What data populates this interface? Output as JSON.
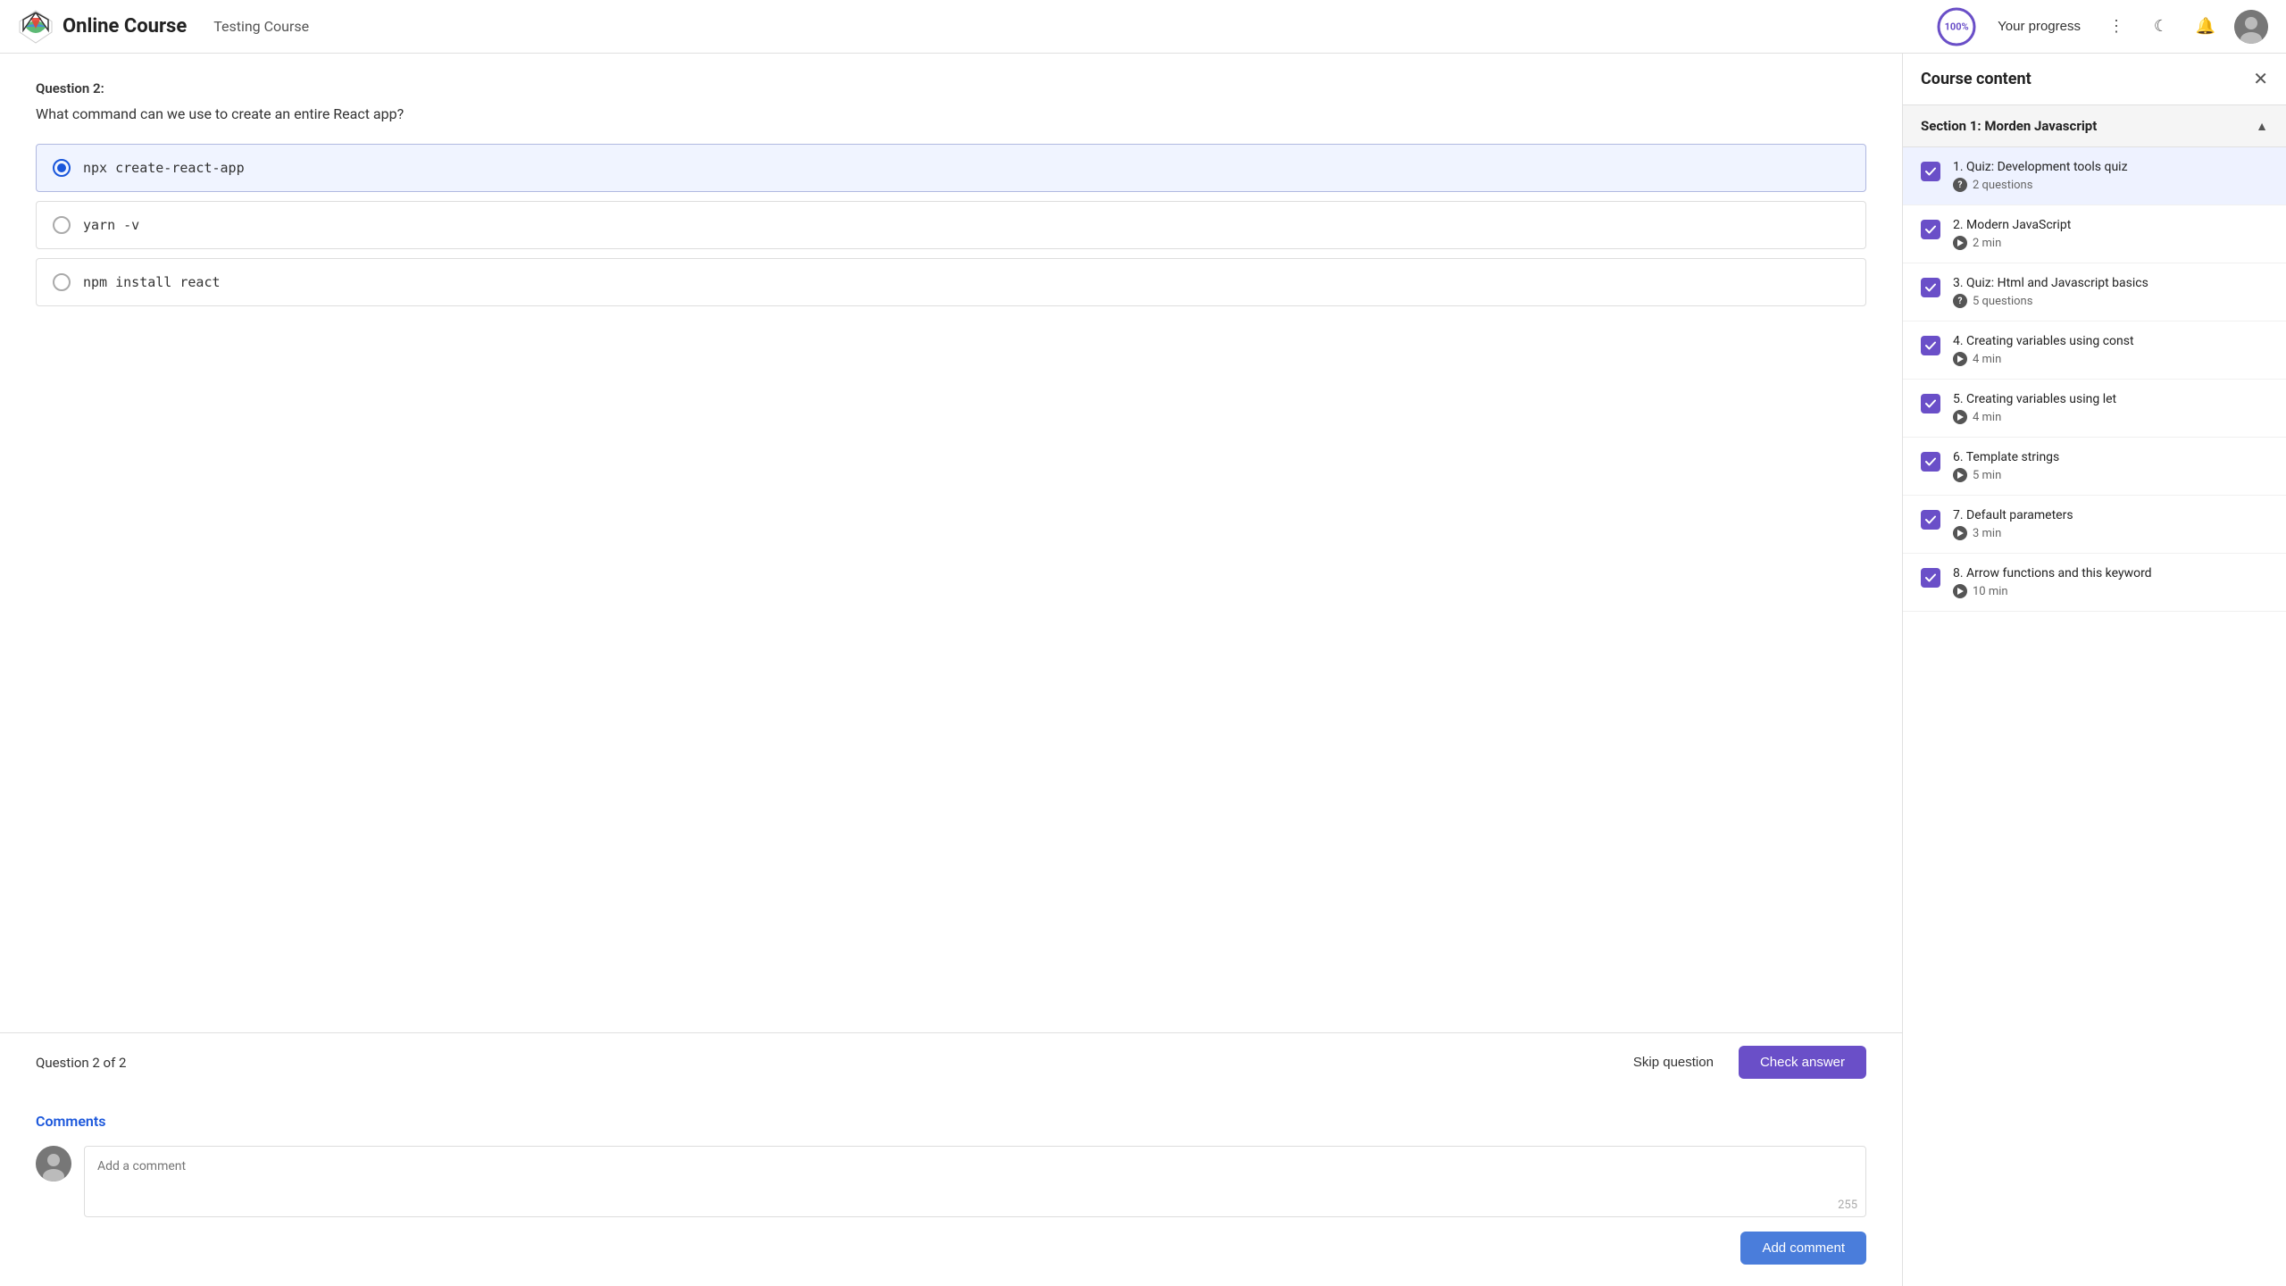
{
  "header": {
    "logo_text": "Online Course",
    "course_title": "Testing Course",
    "progress_percent": "100%",
    "progress_value": 100,
    "your_progress_label": "Your progress",
    "more_icon": "⋮",
    "dark_mode_icon": "☾",
    "bell_icon": "🔔"
  },
  "question": {
    "label": "Question 2:",
    "text": "What command can we use to create an entire React app?",
    "options": [
      {
        "id": "opt1",
        "text": "npx create-react-app",
        "selected": true
      },
      {
        "id": "opt2",
        "text": "yarn -v",
        "selected": false
      },
      {
        "id": "opt3",
        "text": "npm install react",
        "selected": false
      }
    ]
  },
  "bottom_bar": {
    "question_count": "Question 2 of 2",
    "skip_label": "Skip question",
    "check_label": "Check answer"
  },
  "comments": {
    "title": "Comments",
    "placeholder": "Add a comment",
    "char_count": "255",
    "add_button": "Add comment"
  },
  "sidebar": {
    "title": "Course content",
    "close_icon": "✕",
    "section_name": "Section 1: Morden Javascript",
    "items": [
      {
        "number": "1.",
        "title": "Quiz: Development tools quiz",
        "meta_type": "question",
        "meta_text": "2 questions",
        "active": true
      },
      {
        "number": "2.",
        "title": "Modern JavaScript",
        "meta_type": "video",
        "meta_text": "2 min",
        "active": false
      },
      {
        "number": "3.",
        "title": "Quiz: Html and Javascript basics",
        "meta_type": "question",
        "meta_text": "5 questions",
        "active": false
      },
      {
        "number": "4.",
        "title": "Creating variables using const",
        "meta_type": "video",
        "meta_text": "4 min",
        "active": false
      },
      {
        "number": "5.",
        "title": "Creating variables using let",
        "meta_type": "video",
        "meta_text": "4 min",
        "active": false
      },
      {
        "number": "6.",
        "title": "Template strings",
        "meta_type": "video",
        "meta_text": "5 min",
        "active": false
      },
      {
        "number": "7.",
        "title": "Default parameters",
        "meta_type": "video",
        "meta_text": "3 min",
        "active": false
      },
      {
        "number": "8.",
        "title": "Arrow functions and this keyword",
        "meta_type": "video",
        "meta_text": "10 min",
        "active": false
      }
    ]
  }
}
